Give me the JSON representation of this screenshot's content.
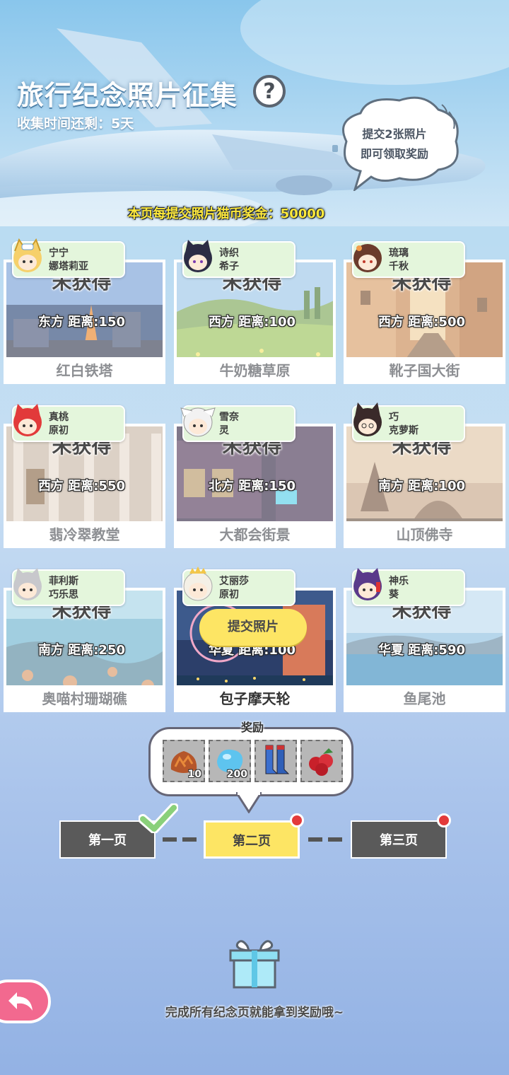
{
  "header": {
    "title": "旅行纪念照片征集",
    "help_symbol": "?",
    "countdown": "收集时间还剩：5天",
    "speech_line1": "提交2张照片",
    "speech_line2": "即可领取奖励",
    "bonus": "本页每提交照片猫币奖金：50000"
  },
  "cards": [
    {
      "char1": "宁宁",
      "char2": "娜塔莉亚",
      "status": "未获得",
      "distance": "东方  距离:150",
      "place": "红白铁塔"
    },
    {
      "char1": "诗织",
      "char2": "希子",
      "status": "未获得",
      "distance": "西方  距离:100",
      "place": "牛奶糖草原"
    },
    {
      "char1": "琉璃",
      "char2": "千秋",
      "status": "未获得",
      "distance": "西方  距离:500",
      "place": "靴子国大街"
    },
    {
      "char1": "真桃",
      "char2": "原初",
      "status": "未获得",
      "distance": "西方  距离:550",
      "place": "翡冷翠教堂"
    },
    {
      "char1": "雪奈",
      "char2": "灵",
      "status": "未获得",
      "distance": "北方  距离:150",
      "place": "大都会街景"
    },
    {
      "char1": "巧",
      "char2": "克萝斯",
      "status": "未获得",
      "distance": "南方  距离:100",
      "place": "山顶佛寺"
    },
    {
      "char1": "菲利斯",
      "char2": "巧乐思",
      "status": "未获得",
      "distance": "南方  距离:250",
      "place": "奥喵村珊瑚礁"
    },
    {
      "char1": "艾丽莎",
      "char2": "原初",
      "submit": "提交照片",
      "distance": "华夏  距离:100",
      "place": "包子摩天轮"
    },
    {
      "char1": "神乐",
      "char2": "葵",
      "status": "未获得",
      "distance": "华夏  距离:590",
      "place": "鱼尾池"
    }
  ],
  "rewards": {
    "label": "奖励",
    "items": [
      {
        "icon": "pinecone-bag-icon",
        "qty": "10"
      },
      {
        "icon": "blue-gem-icon",
        "qty": "200"
      },
      {
        "icon": "blue-boots-icon",
        "qty": ""
      },
      {
        "icon": "red-berries-icon",
        "qty": ""
      }
    ]
  },
  "pager": {
    "page1": "第一页",
    "page2": "第二页",
    "page3": "第三页"
  },
  "footer": {
    "hint": "完成所有纪念页就能拿到奖励哦~"
  },
  "colors": {
    "accent_yellow": "#fde564",
    "tag_green": "#e4f6dc",
    "back_pink": "#f2698f",
    "badge_red": "#e33a3a"
  }
}
